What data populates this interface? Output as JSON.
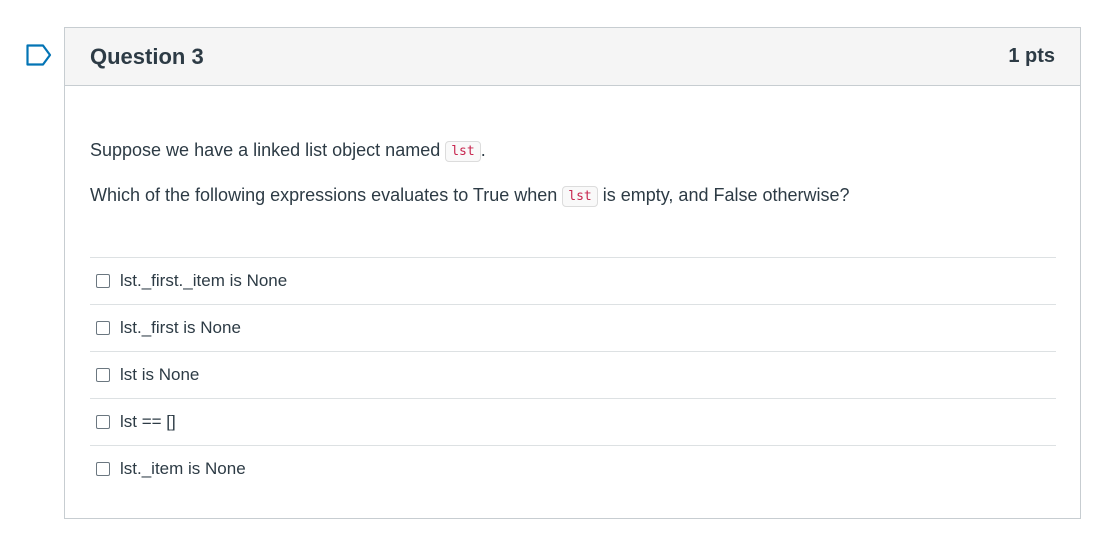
{
  "question": {
    "title": "Question 3",
    "points": "1 pts",
    "prompt_line1_before": "Suppose we have a linked list object named ",
    "prompt_line1_code": "lst",
    "prompt_line1_after": ".",
    "prompt_line2_before": "Which of the following expressions evaluates to True when ",
    "prompt_line2_code": "lst",
    "prompt_line2_after": " is empty, and False otherwise?"
  },
  "answers": [
    {
      "label": "lst._first._item is None",
      "checked": false
    },
    {
      "label": "lst._first is None",
      "checked": false
    },
    {
      "label": "lst is None",
      "checked": false
    },
    {
      "label": "lst == []",
      "checked": false
    },
    {
      "label": "lst._item is None",
      "checked": false
    }
  ],
  "colors": {
    "flag": "#0374b5",
    "header_bg": "#f5f5f5",
    "border": "#c7cdd1",
    "code": "#c7254e"
  }
}
